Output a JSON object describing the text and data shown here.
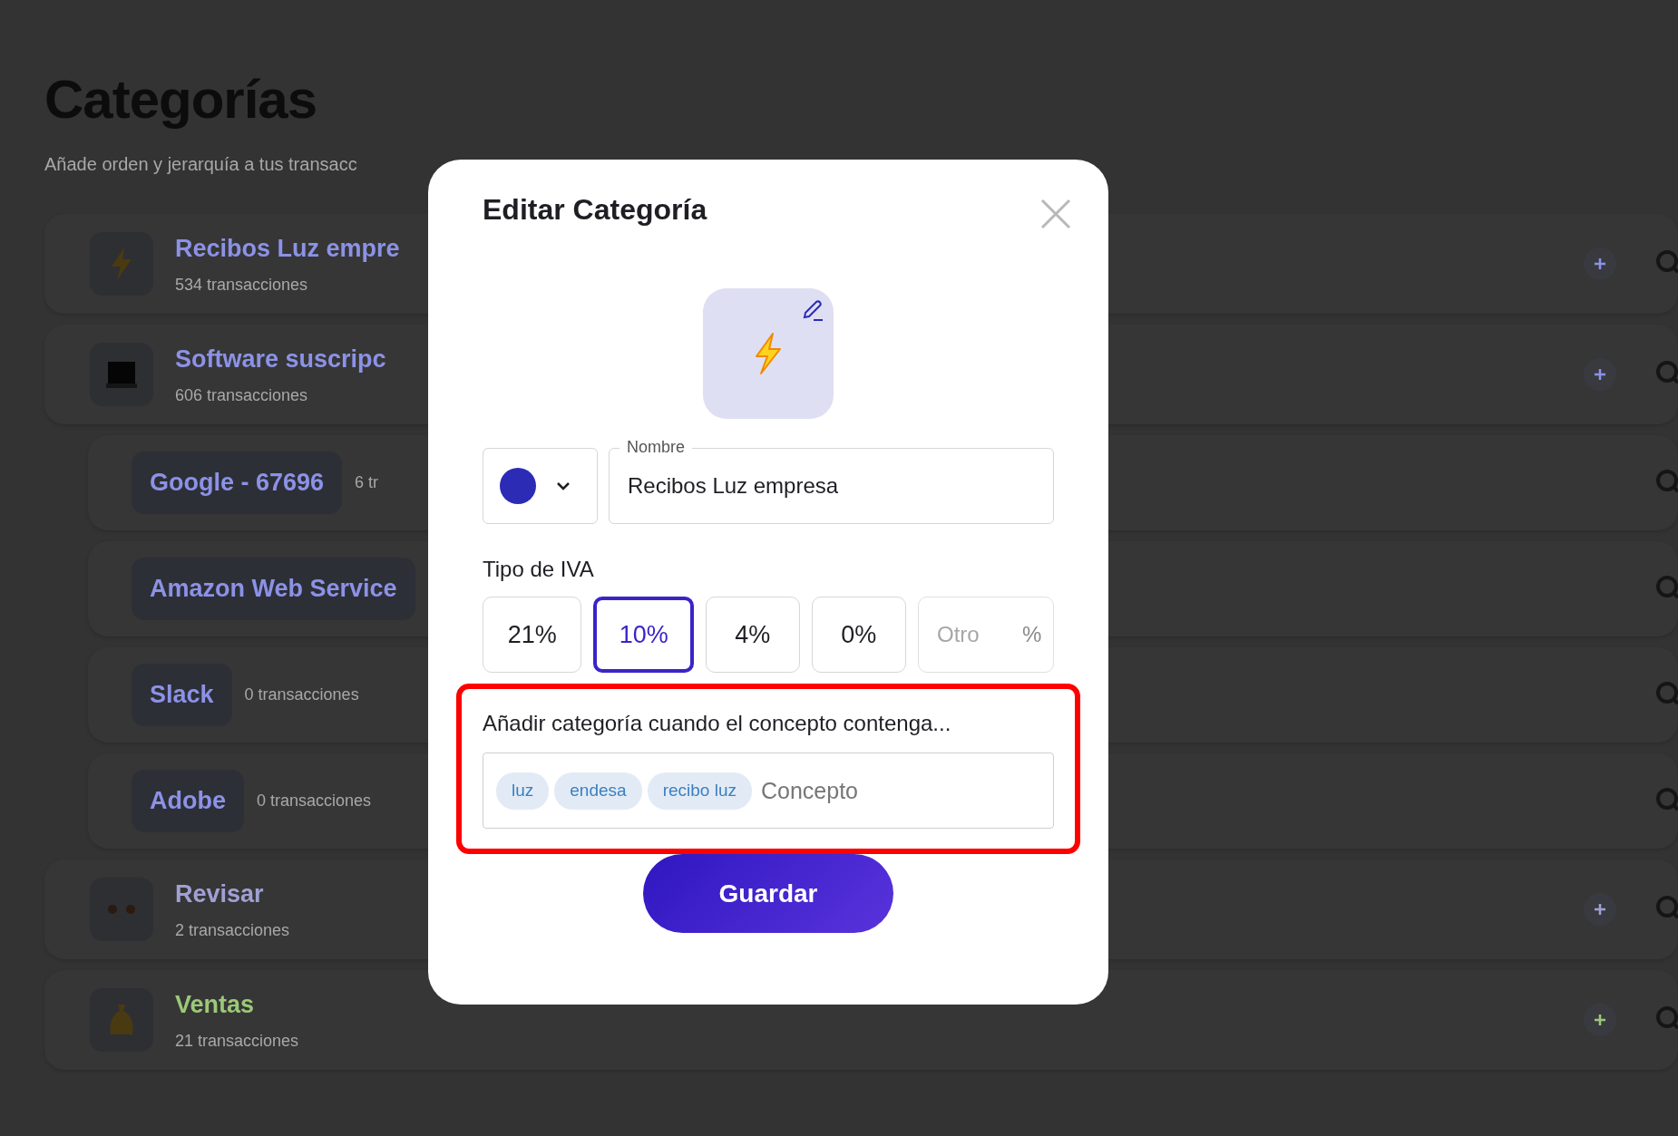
{
  "page": {
    "title": "Categorías",
    "subtitle": "Añade orden y jerarquía a tus transacc"
  },
  "categories": [
    {
      "kind": "parent",
      "name": "Recibos Luz empre",
      "count": "534 transacciones",
      "color": "#8c92e6"
    },
    {
      "kind": "parent",
      "name": "Software suscripc",
      "count": "606 transacciones",
      "color": "#8c92e6"
    },
    {
      "kind": "child",
      "name": "Google - 67696",
      "count": "6 tr",
      "color": "#8c92e6"
    },
    {
      "kind": "child",
      "name": "Amazon Web Service",
      "color": "#8c92e6"
    },
    {
      "kind": "child",
      "name": "Slack",
      "count": "0 transacciones",
      "color": "#8c92e6"
    },
    {
      "kind": "child",
      "name": "Adobe",
      "count": "0 transacciones",
      "color": "#8c92e6"
    },
    {
      "kind": "parent",
      "name": "Revisar",
      "count": "2 transacciones",
      "color": "#a0a0d4"
    },
    {
      "kind": "parent",
      "name": "Ventas",
      "count": "21 transacciones",
      "color": "#9cc878"
    }
  ],
  "modal": {
    "title": "Editar Categoría",
    "color": "#2b2bb5",
    "name_label": "Nombre",
    "name_value": "Recibos Luz empresa",
    "vat_label": "Tipo de IVA",
    "vat_options": [
      {
        "label": "21%",
        "selected": false
      },
      {
        "label": "10%",
        "selected": true
      },
      {
        "label": "4%",
        "selected": false
      },
      {
        "label": "0%",
        "selected": false
      }
    ],
    "vat_other": {
      "placeholder": "Otro",
      "suffix": "%"
    },
    "rule_label": "Añadir categoría cuando el concepto contenga...",
    "highlighted": true,
    "keywords": [
      "luz",
      "endesa",
      "recibo luz"
    ],
    "keyword_placeholder": "Concepto",
    "save": "Guardar"
  }
}
